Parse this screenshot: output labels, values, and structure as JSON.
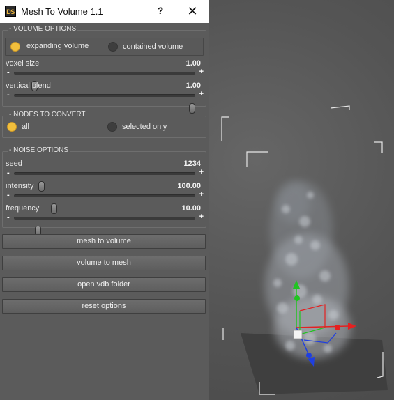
{
  "window": {
    "logo": "DS",
    "title": "Mesh To Volume 1.1",
    "help_label": "?",
    "close_label": "✕"
  },
  "volume_options": {
    "title": "- VOLUME OPTIONS",
    "mode": {
      "options": [
        "expanding volume",
        "contained volume"
      ],
      "selected": "expanding volume"
    },
    "voxel_size": {
      "label": "voxel size",
      "value": "1.00",
      "fraction": 0.11
    },
    "vertical_blend": {
      "label": "vertical blend",
      "value": "1.00",
      "fraction": 0.98
    }
  },
  "nodes_to_convert": {
    "title": "- NODES TO CONVERT",
    "options": [
      "all",
      "selected only"
    ],
    "selected": "all"
  },
  "noise_options": {
    "title": "- NOISE OPTIONS",
    "seed": {
      "label": "seed",
      "value": "1234",
      "fraction": 0.15
    },
    "intensity": {
      "label": "intensity",
      "value": "100.00",
      "fraction": 0.22
    },
    "frequency": {
      "label": "frequency",
      "value": "10.00",
      "fraction": 0.13
    }
  },
  "slider_controls": {
    "minus": "-",
    "plus": "+"
  },
  "actions": {
    "mesh_to_volume": "mesh to volume",
    "volume_to_mesh": "volume to mesh",
    "open_vdb_folder": "open vdb folder",
    "reset_options": "reset options"
  },
  "colors": {
    "accent": "#f2bf3c",
    "panel": "#5b5b5b",
    "viewport": "#555555",
    "gizmo_x": "#e52020",
    "gizmo_y": "#21c421",
    "gizmo_z": "#1f3fe0"
  }
}
